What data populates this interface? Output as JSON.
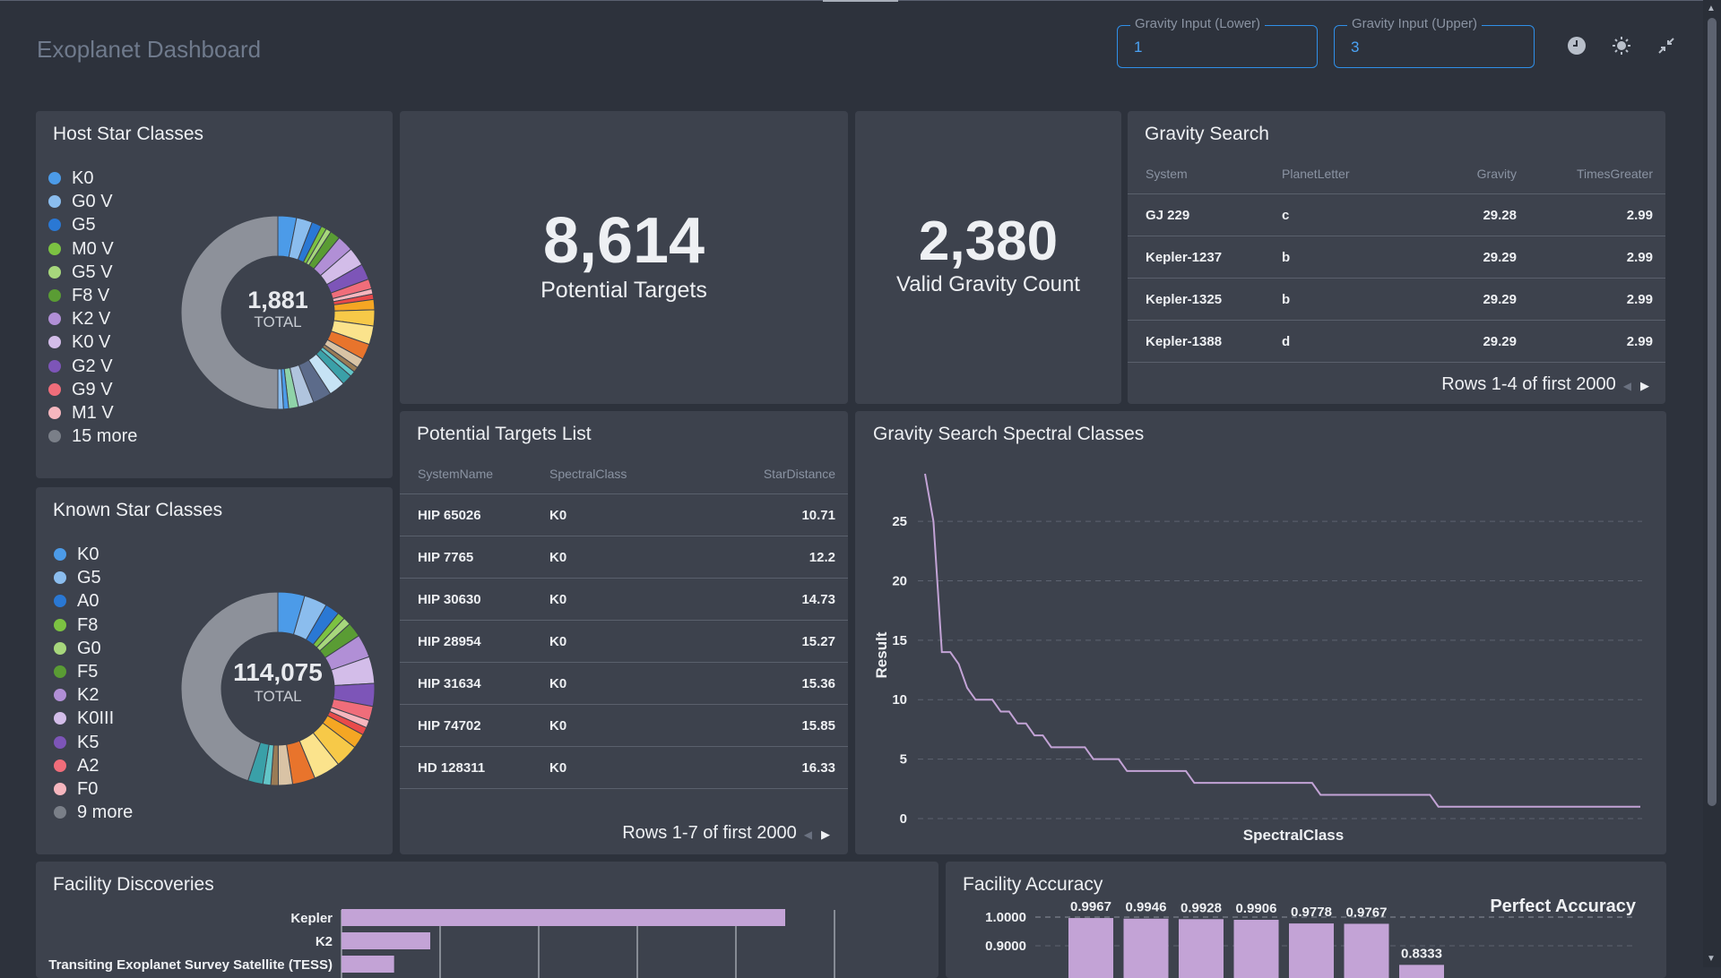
{
  "header": {
    "title": "Exoplanet Dashboard",
    "gravity_lower": {
      "label": "Gravity Input (Lower)",
      "value": "1"
    },
    "gravity_upper": {
      "label": "Gravity Input (Upper)",
      "value": "3"
    },
    "icons": [
      "clock-icon",
      "theme-sun-icon",
      "collapse-icon"
    ]
  },
  "host_star": {
    "title": "Host Star Classes",
    "total": "1,881",
    "total_label": "TOTAL",
    "legend": [
      {
        "label": "K0",
        "color": "#4c9be8"
      },
      {
        "label": "G0 V",
        "color": "#8bbdee"
      },
      {
        "label": "G5",
        "color": "#2a78d4"
      },
      {
        "label": "M0 V",
        "color": "#7cc242"
      },
      {
        "label": "G5 V",
        "color": "#a7d77c"
      },
      {
        "label": "F8 V",
        "color": "#5a9c34"
      },
      {
        "label": "K2 V",
        "color": "#b18fd6"
      },
      {
        "label": "K0 V",
        "color": "#d3bde9"
      },
      {
        "label": "G2 V",
        "color": "#7d55b8"
      },
      {
        "label": "G9 V",
        "color": "#f06d7a"
      },
      {
        "label": "M1 V",
        "color": "#f6b6be"
      },
      {
        "label": "15 more",
        "color": "#7a7f88"
      }
    ]
  },
  "known_star": {
    "title": "Known Star Classes",
    "total": "114,075",
    "total_label": "TOTAL",
    "legend": [
      {
        "label": "K0",
        "color": "#4c9be8"
      },
      {
        "label": "G5",
        "color": "#8bbdee"
      },
      {
        "label": "A0",
        "color": "#2a78d4"
      },
      {
        "label": "F8",
        "color": "#7cc242"
      },
      {
        "label": "G0",
        "color": "#a7d77c"
      },
      {
        "label": "F5",
        "color": "#5a9c34"
      },
      {
        "label": "K2",
        "color": "#b18fd6"
      },
      {
        "label": "K0III",
        "color": "#d3bde9"
      },
      {
        "label": "K5",
        "color": "#7d55b8"
      },
      {
        "label": "A2",
        "color": "#f06d7a"
      },
      {
        "label": "F0",
        "color": "#f6b6be"
      },
      {
        "label": "9 more",
        "color": "#7a7f88"
      }
    ]
  },
  "potential_targets": {
    "value": "8,614",
    "label": "Potential Targets"
  },
  "valid_gravity": {
    "value": "2,380",
    "label": "Valid Gravity Count"
  },
  "gravity_search": {
    "title": "Gravity Search",
    "columns": [
      "System",
      "PlanetLetter",
      "Gravity",
      "TimesGreater"
    ],
    "rows": [
      [
        "GJ 229",
        "c",
        "29.28",
        "2.99"
      ],
      [
        "Kepler-1237",
        "b",
        "29.29",
        "2.99"
      ],
      [
        "Kepler-1325",
        "b",
        "29.29",
        "2.99"
      ],
      [
        "Kepler-1388",
        "d",
        "29.29",
        "2.99"
      ]
    ],
    "pager": "Rows 1-4 of first 2000"
  },
  "targets_list": {
    "title": "Potential Targets List",
    "columns": [
      "SystemName",
      "SpectralClass",
      "StarDistance"
    ],
    "rows": [
      [
        "HIP 65026",
        "K0",
        "10.71"
      ],
      [
        "HIP 7765",
        "K0",
        "12.2"
      ],
      [
        "HIP 30630",
        "K0",
        "14.73"
      ],
      [
        "HIP 28954",
        "K0",
        "15.27"
      ],
      [
        "HIP 31634",
        "K0",
        "15.36"
      ],
      [
        "HIP 74702",
        "K0",
        "15.85"
      ],
      [
        "HD 128311",
        "K0",
        "16.33"
      ]
    ],
    "pager": "Rows 1-7 of first 2000"
  },
  "chart_data": [
    {
      "type": "line",
      "title": "Gravity Search Spectral Classes",
      "xlabel": "SpectralClass",
      "ylabel": "Result",
      "ylim": [
        0,
        29
      ],
      "yticks": [
        0,
        5,
        10,
        15,
        20,
        25
      ],
      "grid": true,
      "color": "#c3a3d6",
      "values": [
        29,
        25,
        14,
        14,
        13,
        11,
        10,
        10,
        10,
        9,
        9,
        8,
        8,
        7,
        7,
        6,
        6,
        6,
        6,
        6,
        5,
        5,
        5,
        5,
        4,
        4,
        4,
        4,
        4,
        4,
        4,
        4,
        3,
        3,
        3,
        3,
        3,
        3,
        3,
        3,
        3,
        3,
        3,
        3,
        3,
        3,
        3,
        2,
        2,
        2,
        2,
        2,
        2,
        2,
        2,
        2,
        2,
        2,
        2,
        2,
        2,
        1,
        1,
        1,
        1,
        1,
        1,
        1,
        1,
        1,
        1,
        1,
        1,
        1,
        1,
        1,
        1,
        1,
        1,
        1,
        1,
        1,
        1,
        1,
        1,
        1
      ]
    },
    {
      "type": "bar",
      "orientation": "horizontal",
      "title": "Facility Discoveries",
      "categories": [
        "Kepler",
        "K2",
        "Transiting Exoplanet Survey Satellite (TESS)"
      ],
      "values": [
        2700,
        540,
        320
      ],
      "xlim": [
        0,
        3000
      ],
      "color": "#c3a3d6"
    },
    {
      "type": "bar",
      "title": "Facility Accuracy",
      "values": [
        0.9967,
        0.9946,
        0.9928,
        0.9906,
        0.9778,
        0.9767,
        0.8333
      ],
      "value_labels": [
        "0.9967",
        "0.9946",
        "0.9928",
        "0.9906",
        "0.9778",
        "0.9767",
        "0.8333"
      ],
      "yticks": [
        "1.0000",
        "0.9000"
      ],
      "reference_line": {
        "value": 1.0,
        "label": "Perfect Accuracy"
      },
      "color": "#c3a3d6"
    }
  ]
}
